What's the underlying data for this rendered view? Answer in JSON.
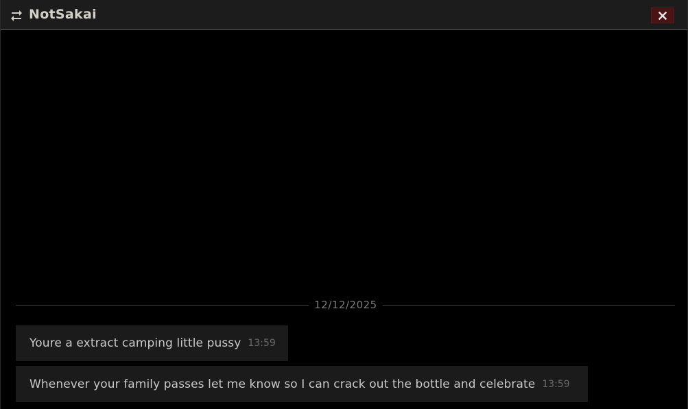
{
  "window": {
    "title": "NotSakai",
    "title_icon": "swap-arrows-icon",
    "close_icon": "close-icon"
  },
  "chat": {
    "date_divider": "12/12/2025",
    "messages": [
      {
        "text": "Youre a extract camping little pussy",
        "time": "13:59"
      },
      {
        "text": "Whenever your family passes let me know so I can crack out the bottle and celebrate",
        "time": "13:59"
      }
    ]
  },
  "colors": {
    "background": "#000000",
    "titlebar": "#1c1c1c",
    "title_text": "#d4d2c8",
    "close_button": "#4a1414",
    "message_bubble": "#1b1b1b",
    "message_text": "#c9c9c9",
    "timestamp": "#6b6b6b"
  }
}
